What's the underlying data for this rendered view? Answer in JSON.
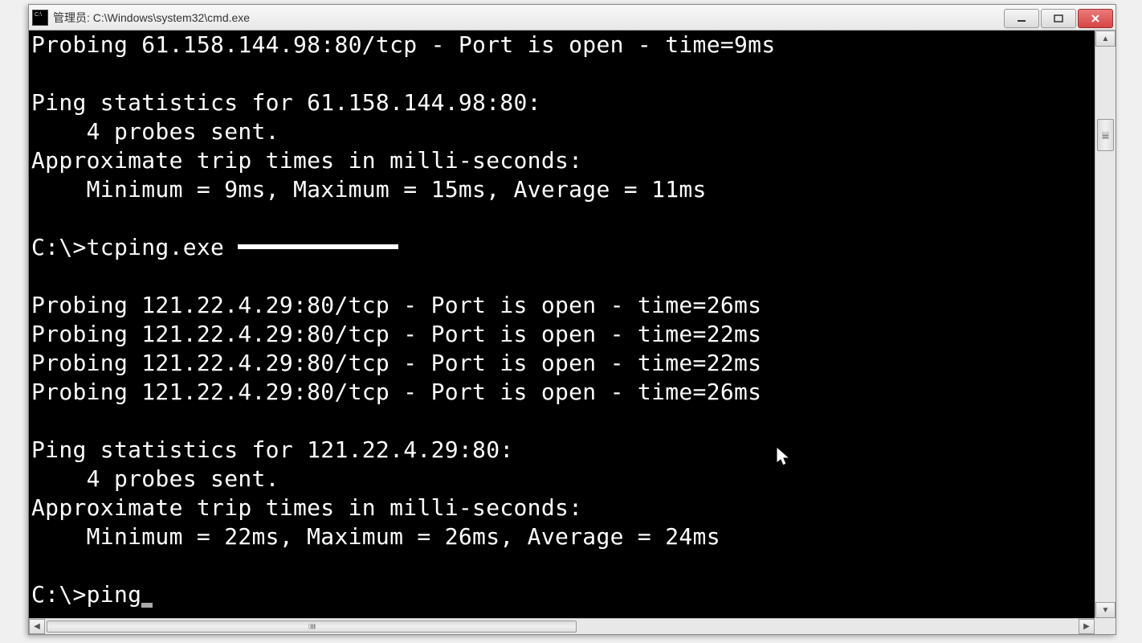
{
  "window": {
    "title": "管理员: C:\\Windows\\system32\\cmd.exe"
  },
  "terminal": {
    "lines": {
      "probe1": "Probing 61.158.144.98:80/tcp - Port is open - time=9ms",
      "blank1": "",
      "stats1_header": "Ping statistics for 61.158.144.98:80:",
      "stats1_probes": "    4 probes sent.",
      "stats1_approx": "Approximate trip times in milli-seconds:",
      "stats1_times": "    Minimum = 9ms, Maximum = 15ms, Average = 11ms",
      "blank2": "",
      "cmd1_prefix": "C:\\>tcping.exe ",
      "blank3": "",
      "probe2a": "Probing 121.22.4.29:80/tcp - Port is open - time=26ms",
      "probe2b": "Probing 121.22.4.29:80/tcp - Port is open - time=22ms",
      "probe2c": "Probing 121.22.4.29:80/tcp - Port is open - time=22ms",
      "probe2d": "Probing 121.22.4.29:80/tcp - Port is open - time=26ms",
      "blank4": "",
      "stats2_header": "Ping statistics for 121.22.4.29:80:",
      "stats2_probes": "    4 probes sent.",
      "stats2_approx": "Approximate trip times in milli-seconds:",
      "stats2_times": "    Minimum = 22ms, Maximum = 26ms, Average = 24ms",
      "blank5": "",
      "cmd2": "C:\\>ping"
    }
  }
}
